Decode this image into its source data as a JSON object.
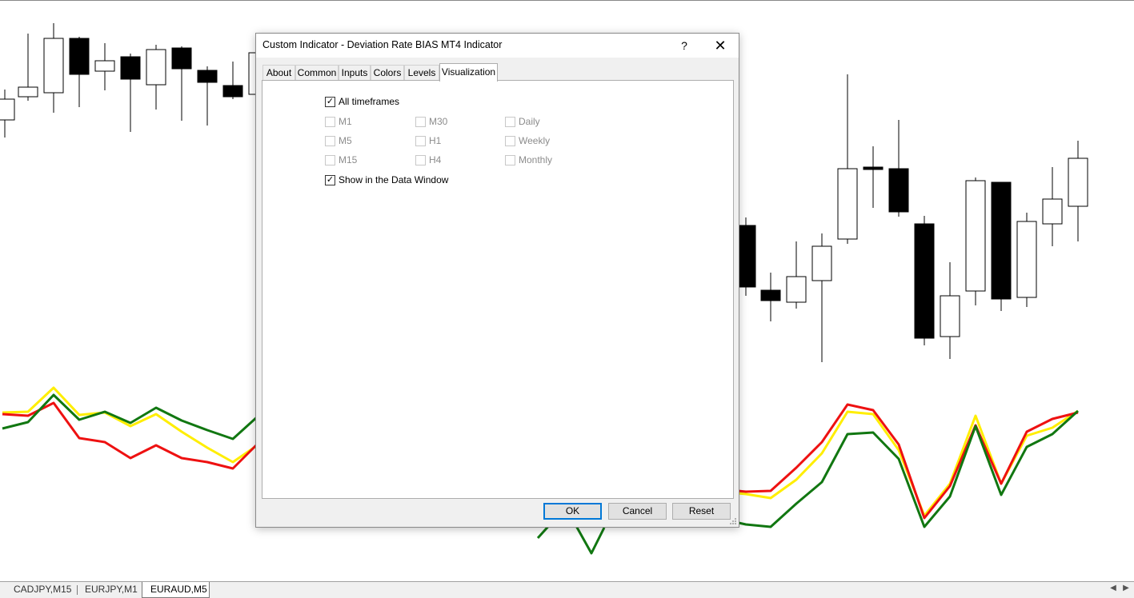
{
  "dialog": {
    "title": "Custom Indicator - Deviation Rate BIAS MT4 Indicator",
    "help_label": "?",
    "close_label": "✕",
    "tabs": [
      "About",
      "Common",
      "Inputs",
      "Colors",
      "Levels",
      "Visualization"
    ],
    "active_tab": "Visualization",
    "visualization": {
      "all_timeframes": {
        "label": "All timeframes",
        "checked": true
      },
      "timeframes": [
        {
          "label": "M1",
          "checked": false,
          "enabled": false
        },
        {
          "label": "M5",
          "checked": false,
          "enabled": false
        },
        {
          "label": "M15",
          "checked": false,
          "enabled": false
        },
        {
          "label": "M30",
          "checked": false,
          "enabled": false
        },
        {
          "label": "H1",
          "checked": false,
          "enabled": false
        },
        {
          "label": "H4",
          "checked": false,
          "enabled": false
        },
        {
          "label": "Daily",
          "checked": false,
          "enabled": false
        },
        {
          "label": "Weekly",
          "checked": false,
          "enabled": false
        },
        {
          "label": "Monthly",
          "checked": false,
          "enabled": false
        }
      ],
      "show_in_data_window": {
        "label": "Show in the Data Window",
        "checked": true
      }
    },
    "buttons": {
      "ok": "OK",
      "cancel": "Cancel",
      "reset": "Reset"
    }
  },
  "chart_tabs": [
    "CADJPY,M15",
    "EURJPY,M1",
    "EURAUD,M5"
  ],
  "active_chart_tab": "EURAUD,M5",
  "colors": {
    "bull_candle": "#ffffff",
    "bear_candle": "#000000",
    "line_red": "#ee1111",
    "line_yellow": "#ffee00",
    "line_green": "#117711",
    "accent": "#0078d7"
  }
}
